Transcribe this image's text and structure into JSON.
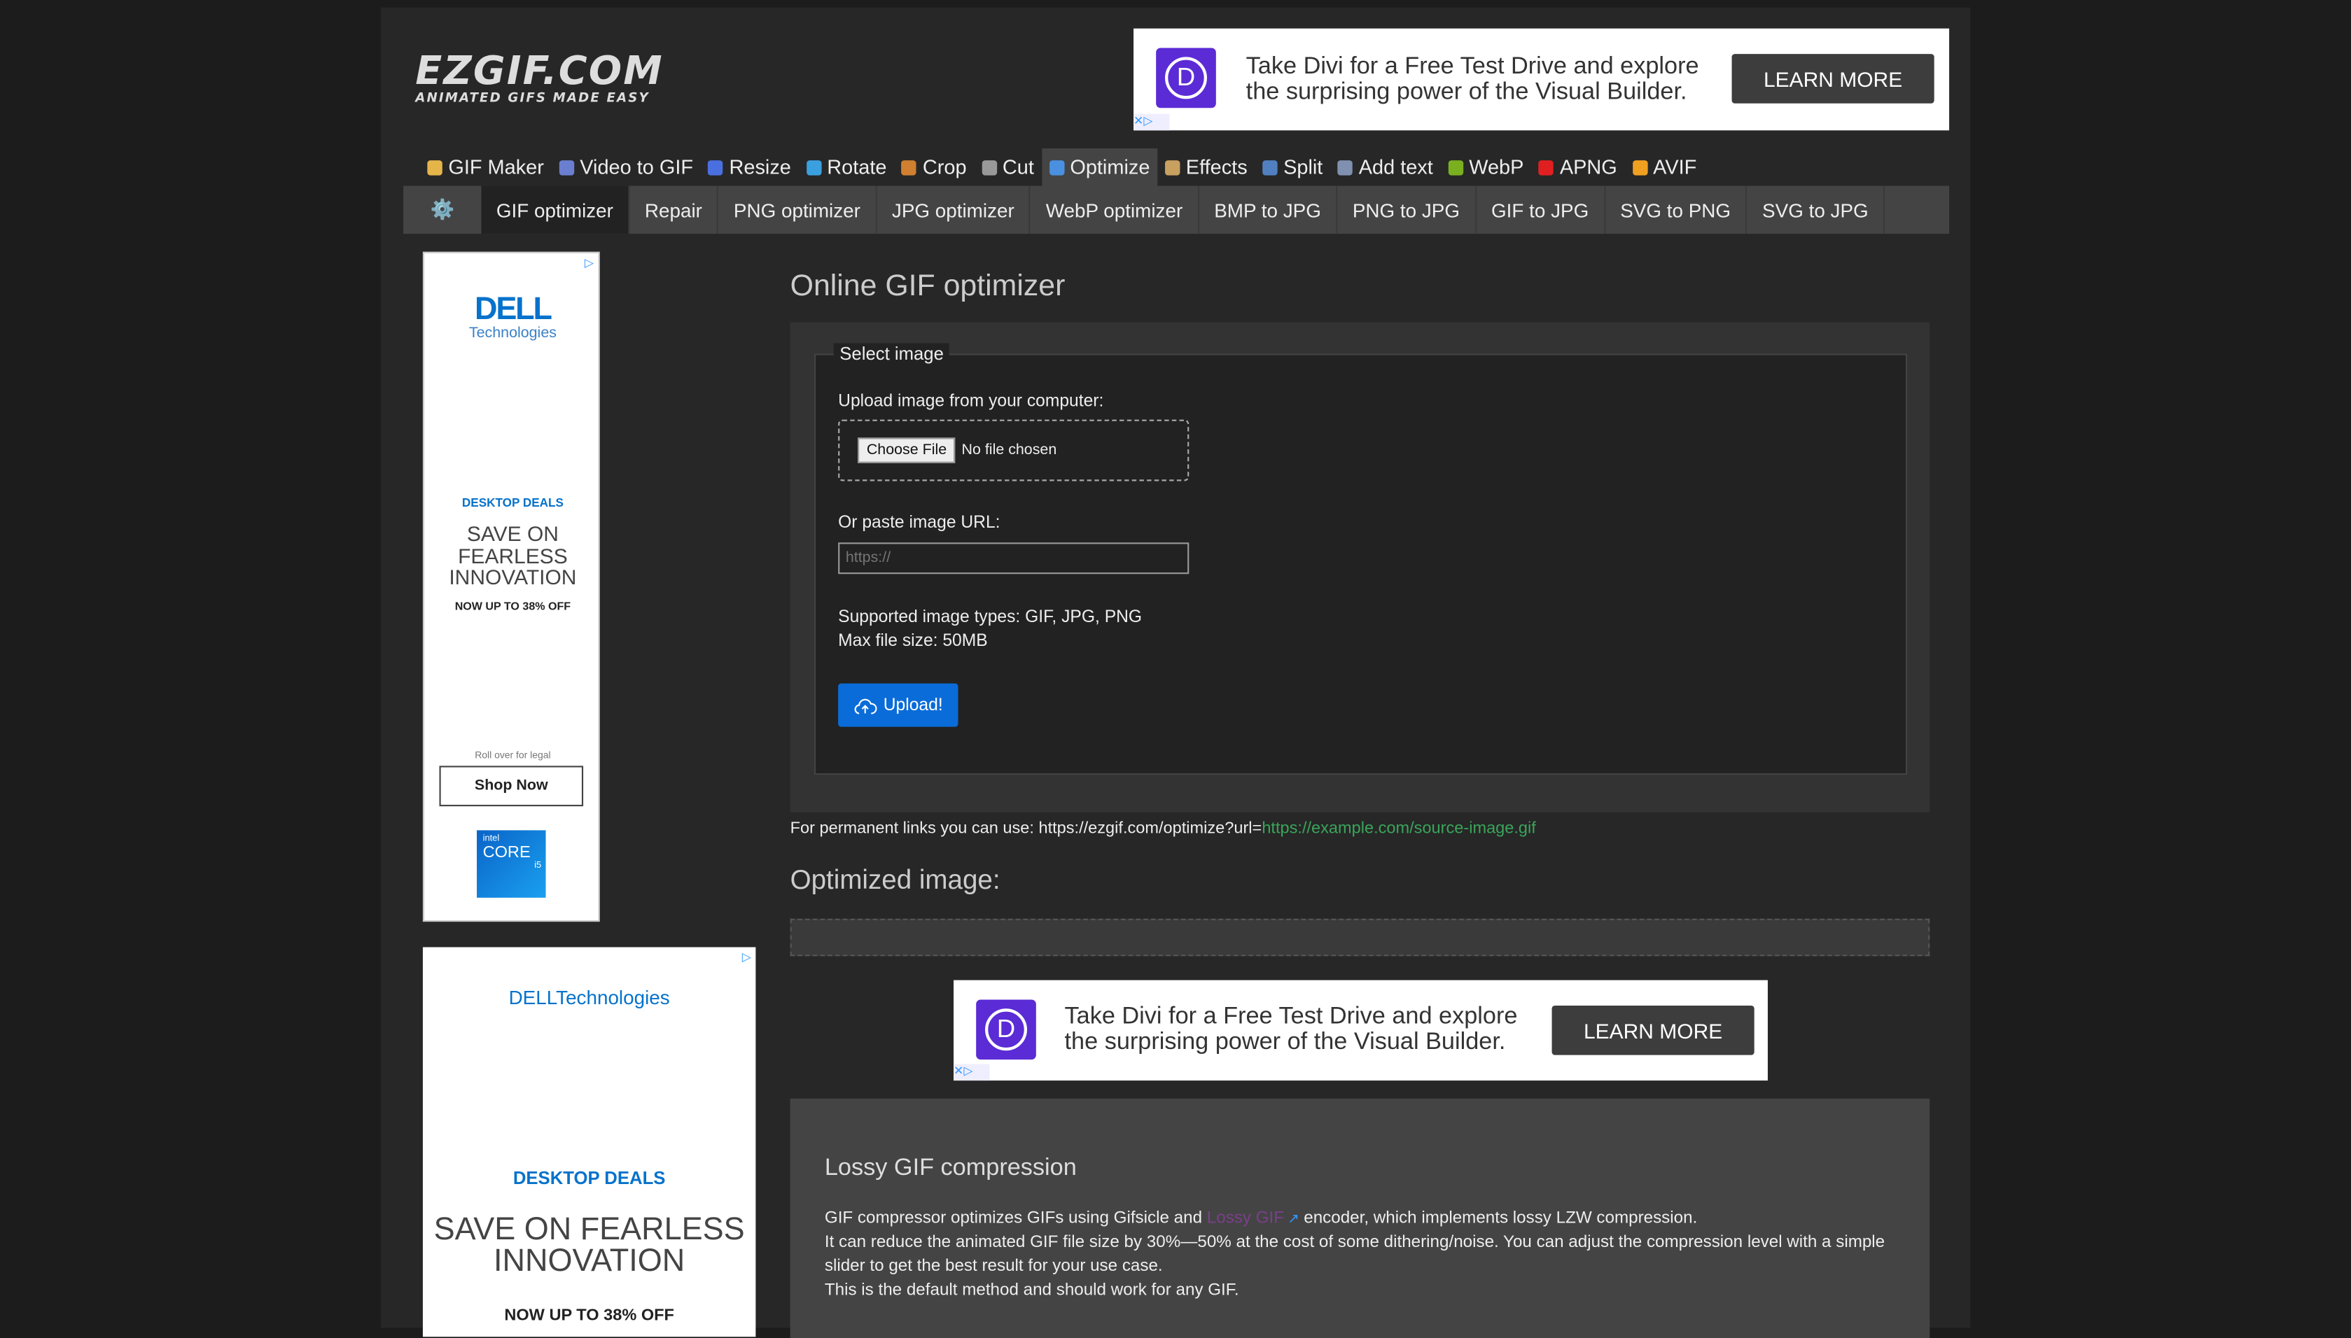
{
  "logo": {
    "name": "EZGIF.COM",
    "tagline": "ANIMATED GIFS MADE EASY"
  },
  "top_ad": {
    "text_line1": "Take Divi for a Free Test Drive and explore",
    "text_line2": "the surprising power of the Visual Builder.",
    "button": "LEARN MORE",
    "logo_letter": "D"
  },
  "nav": [
    {
      "label": "GIF Maker",
      "color": "#e6b54a"
    },
    {
      "label": "Video to GIF",
      "color": "#6a7fd0"
    },
    {
      "label": "Resize",
      "color": "#4a6fe0"
    },
    {
      "label": "Rotate",
      "color": "#3aa0e0"
    },
    {
      "label": "Crop",
      "color": "#d08030"
    },
    {
      "label": "Cut",
      "color": "#999999"
    },
    {
      "label": "Optimize",
      "color": "#4a90e0",
      "active": true
    },
    {
      "label": "Effects",
      "color": "#c8a060"
    },
    {
      "label": "Split",
      "color": "#5080c0"
    },
    {
      "label": "Add text",
      "color": "#8090b0"
    },
    {
      "label": "WebP",
      "color": "#7ab020"
    },
    {
      "label": "APNG",
      "color": "#e02020"
    },
    {
      "label": "AVIF",
      "color": "#f0a020"
    }
  ],
  "subnav": [
    "GIF optimizer",
    "Repair",
    "PNG optimizer",
    "JPG optimizer",
    "WebP optimizer",
    "BMP to JPG",
    "PNG to JPG",
    "GIF to JPG",
    "SVG to PNG",
    "SVG to JPG"
  ],
  "left_ad": {
    "brand": "DELL",
    "brand_sub": "Technologies",
    "deals": "DESKTOP DEALS",
    "headline": "SAVE ON FEARLESS INNOVATION",
    "offer": "NOW UP TO 38% OFF",
    "legal": "Roll over for legal",
    "button": "Shop Now",
    "chip_brand": "intel",
    "chip": "CORE",
    "chip_model": "i5"
  },
  "left_ad2": {
    "brand": "DELLTechnologies",
    "deals": "DESKTOP DEALS",
    "headline": "SAVE ON FEARLESS INNOVATION",
    "offer": "NOW UP TO 38% OFF"
  },
  "main": {
    "title": "Online GIF optimizer",
    "legend": "Select image",
    "upload_label": "Upload image from your computer:",
    "choose_file": "Choose File",
    "no_file": "No file chosen",
    "url_label": "Or paste image URL:",
    "url_placeholder": "https://",
    "supported": "Supported image types: GIF, JPG, PNG",
    "max_size": "Max file size: 50MB",
    "upload_button": "Upload!",
    "perm_prefix": "For permanent links you can use: https://ezgif.com/optimize?url=",
    "perm_link": "https://example.com/source-image.gif",
    "optimized_title": "Optimized image:"
  },
  "mid_ad": {
    "text_line1": "Take Divi for a Free Test Drive and explore",
    "text_line2": "the surprising power of the Visual Builder.",
    "button": "LEARN MORE",
    "logo_letter": "D"
  },
  "lossy": {
    "title": "Lossy GIF compression",
    "p1a": "GIF compressor optimizes GIFs using Gifsicle and ",
    "p1link": "Lossy GIF",
    "p1b": " encoder, which implements lossy LZW compression.",
    "p2": "It can reduce the animated GIF file size by 30%—50% at the cost of some dithering/noise. You can adjust the compression level with a simple slider to get the best result for your use case.",
    "p3": "This is the default method and should work for any GIF."
  }
}
